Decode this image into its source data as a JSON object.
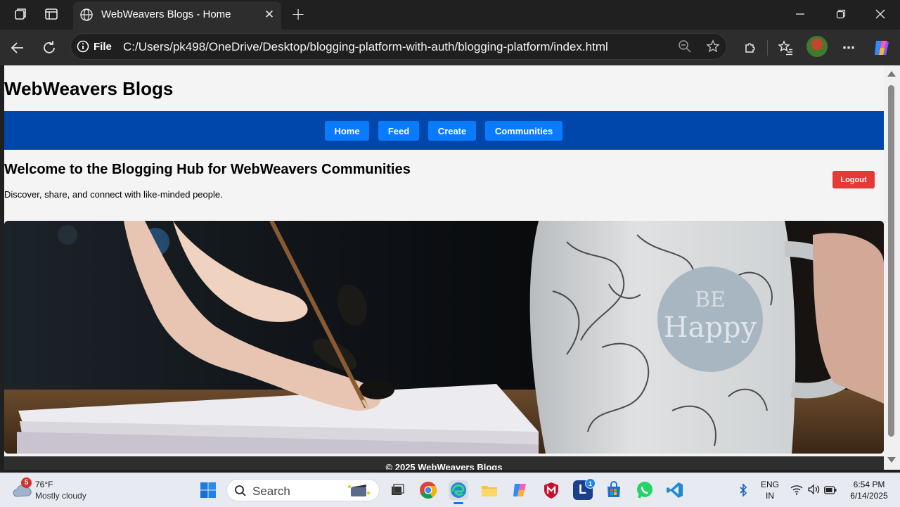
{
  "browser": {
    "tab_title": "WebWeavers Blogs - Home",
    "address_chip": "File",
    "url": "C:/Users/pk498/OneDrive/Desktop/blogging-platform-with-auth/blogging-platform/index.html"
  },
  "site": {
    "title": "WebWeavers Blogs",
    "nav": [
      "Home",
      "Feed",
      "Create",
      "Communities"
    ],
    "welcome_heading": "Welcome to the Blogging Hub for WebWeavers Communities",
    "welcome_text": "Discover, share, and connect with like-minded people.",
    "logout_label": "Logout",
    "footer": "© 2025 WebWeavers Blogs",
    "hero_mug_text": [
      "BE",
      "Happy"
    ]
  },
  "taskbar": {
    "weather_badge": "5",
    "weather_temp": "76°F",
    "weather_desc": "Mostly cloudy",
    "search_label": "Search",
    "store_badge": "1",
    "lang_top": "ENG",
    "lang_bottom": "IN",
    "time": "6:54 PM",
    "date": "6/14/2025"
  },
  "colors": {
    "nav_bar": "#0047ab",
    "nav_button": "#0a7bff",
    "logout": "#e53935",
    "page_bg": "#f4f4f4"
  }
}
